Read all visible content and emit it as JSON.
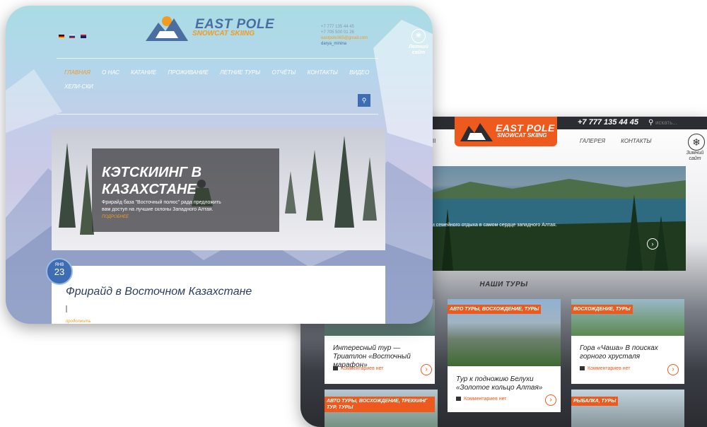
{
  "summer_site": {
    "logo": {
      "title": "EAST POLE",
      "subtitle": "SNOWCAT SKIING"
    },
    "phone": "+7 777 135 44 45",
    "search_icon": "search-icon",
    "search_placeholder": "искать...",
    "nav_left": "ЫI",
    "nav": [
      "ГАЛЕРЕЯ",
      "КОНТАКТЫ"
    ],
    "winter_switch": {
      "icon": "snowflake-icon",
      "label": "Зимний сайт"
    },
    "hero": {
      "text": "о и семейного отдыха в самом сердце западного Алтая."
    },
    "tours_title": "НАШИ ТУРЫ",
    "tours": [
      {
        "tags": "",
        "title": "Интересный тур — Триатлон «Восточный марафон»",
        "comments": "Комментариев нет"
      },
      {
        "tags": "АВТО ТУРЫ, ВОСХОЖДЕНИЕ, ТУРЫ",
        "title": "Тур к подножию Белухи «Золотое кольцо Алтая»",
        "comments": "Комментариев нет"
      },
      {
        "tags": "ВОСХОЖДЕНИЕ, ТУРЫ",
        "title": "Гора «Чаша» В поисках горного хрусталя",
        "comments": "Комментариев нет"
      },
      {
        "tags": "АВТО ТУРЫ, ВОСХОЖДЕНИЕ, ТРЕККИНГ ТУР, ТУРЫ",
        "title": "",
        "comments": ""
      },
      {
        "tags": "РЫБАЛКА, ТУРЫ",
        "title": "",
        "comments": ""
      }
    ],
    "colors": {
      "accent": "#ee5a1d",
      "dark": "#2b2d33"
    }
  },
  "winter_site": {
    "languages": [
      "de",
      "ru",
      "en"
    ],
    "logo": {
      "title": "EAST POLE",
      "subtitle": "SNOWCAT SKIING"
    },
    "contacts": {
      "phone1": "+7 777 135 44 45",
      "phone2": "+7 705 500 01 26",
      "email": "eastpole365@gmail.com",
      "skype": "darya_minina"
    },
    "summer_switch": {
      "icon": "leaf-icon",
      "label": "Летний сайт"
    },
    "nav": [
      "ГЛАВНАЯ",
      "О НАС",
      "КАТАНИЕ",
      "ПРОЖИВАНИЕ",
      "ЛЕТНИЕ ТУРЫ",
      "ОТЧЁТЫ",
      "КОНТАКТЫ",
      "ВИДЕО"
    ],
    "nav_second": "ХЕЛИ-СКИ",
    "search_icon": "search-icon",
    "slide": {
      "title": "КЭТСКИИНГ В КАЗАХСТАНЕ",
      "text": "Фрирайд база \"Восточный полюс\" рада предложить вам доступ на лучшие склоны Западного Алтая.",
      "more": "ПОДРОБНЕЕ"
    },
    "post": {
      "date_month": "ЯНВ",
      "date_day": "23",
      "title": "Фрирайд в Восточном Казахстане",
      "more": "продолжить"
    },
    "colors": {
      "accent": "#f29b1f",
      "brand": "#3d6db3"
    }
  }
}
